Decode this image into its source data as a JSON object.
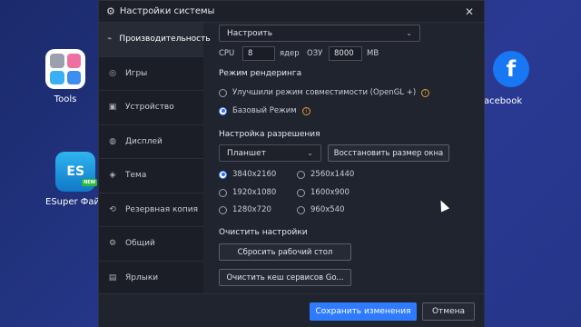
{
  "desktop": {
    "tools_label": "Tools",
    "esuper_label": "ESuper Файл",
    "esuper_tile_text": "ES",
    "esuper_badge": "NEW",
    "facebook_label": "acebook",
    "facebook_glyph": "f"
  },
  "window": {
    "title": "Настройки системы",
    "close_glyph": "✕"
  },
  "sidebar": {
    "items": [
      {
        "label": "Производительность",
        "icon": "performance-icon",
        "glyph": "⌁"
      },
      {
        "label": "Игры",
        "icon": "gamepad-icon",
        "glyph": "◎"
      },
      {
        "label": "Устройство",
        "icon": "device-icon",
        "glyph": "▣"
      },
      {
        "label": "Дисплей",
        "icon": "display-icon",
        "glyph": "◍"
      },
      {
        "label": "Тема",
        "icon": "theme-icon",
        "glyph": "◈"
      },
      {
        "label": "Резервная копия",
        "icon": "backup-icon",
        "glyph": "⟲"
      },
      {
        "label": "Общий",
        "icon": "general-icon",
        "glyph": "⚙"
      },
      {
        "label": "Ярлыки",
        "icon": "shortcuts-icon",
        "glyph": "▤"
      }
    ]
  },
  "performance": {
    "preset_value": "Настроить",
    "cpu_label": "CPU",
    "cpu_value": "8",
    "cpu_unit": "ядер",
    "ram_label": "ОЗУ",
    "ram_value": "8000",
    "ram_unit": "MB"
  },
  "render": {
    "title": "Режим рендеринга",
    "options": [
      {
        "label": "Улучшили режим совместимости (OpenGL +)",
        "selected": false
      },
      {
        "label": "Базовый Режим",
        "selected": true
      }
    ],
    "info_glyph": "i"
  },
  "resolution": {
    "title": "Настройка разрешения",
    "device_value": "Планшет",
    "restore_button": "Восстановить размер окна",
    "options": [
      {
        "label": "3840x2160",
        "selected": true
      },
      {
        "label": "2560x1440",
        "selected": false
      },
      {
        "label": "1920x1080",
        "selected": false
      },
      {
        "label": "1600x900",
        "selected": false
      },
      {
        "label": "1280x720",
        "selected": false
      },
      {
        "label": "960x540",
        "selected": false
      }
    ]
  },
  "clear": {
    "title": "Очистить настройки",
    "reset_desktop_button": "Сбросить рабочий стол",
    "clear_cache_button": "Очистить кеш сервисов Go..."
  },
  "footer": {
    "save_button": "Сохранить изменения",
    "cancel_button": "Отмена"
  },
  "colors": {
    "accent": "#2f7bff",
    "info": "#e0a030"
  }
}
